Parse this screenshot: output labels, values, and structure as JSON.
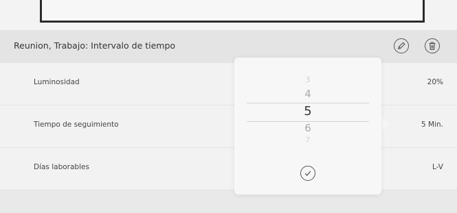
{
  "header": {
    "title": "Reunion, Trabajo: Intervalo de tiempo",
    "edit_icon": "pencil-icon",
    "delete_icon": "trash-icon"
  },
  "rows": [
    {
      "label": "Luminosidad",
      "value": "20%"
    },
    {
      "label": "Tiempo de seguimiento",
      "value": "5 Min."
    },
    {
      "label": "Días laborables",
      "value": "L-V"
    }
  ],
  "picker": {
    "items": [
      "3",
      "4",
      "5",
      "6",
      "7"
    ],
    "selected": "5",
    "confirm_icon": "checkmark-icon"
  },
  "colors": {
    "background": "#ededed",
    "header": "#e4e4e4",
    "popover": "#f7f7f7",
    "text": "#3a3a3a"
  }
}
